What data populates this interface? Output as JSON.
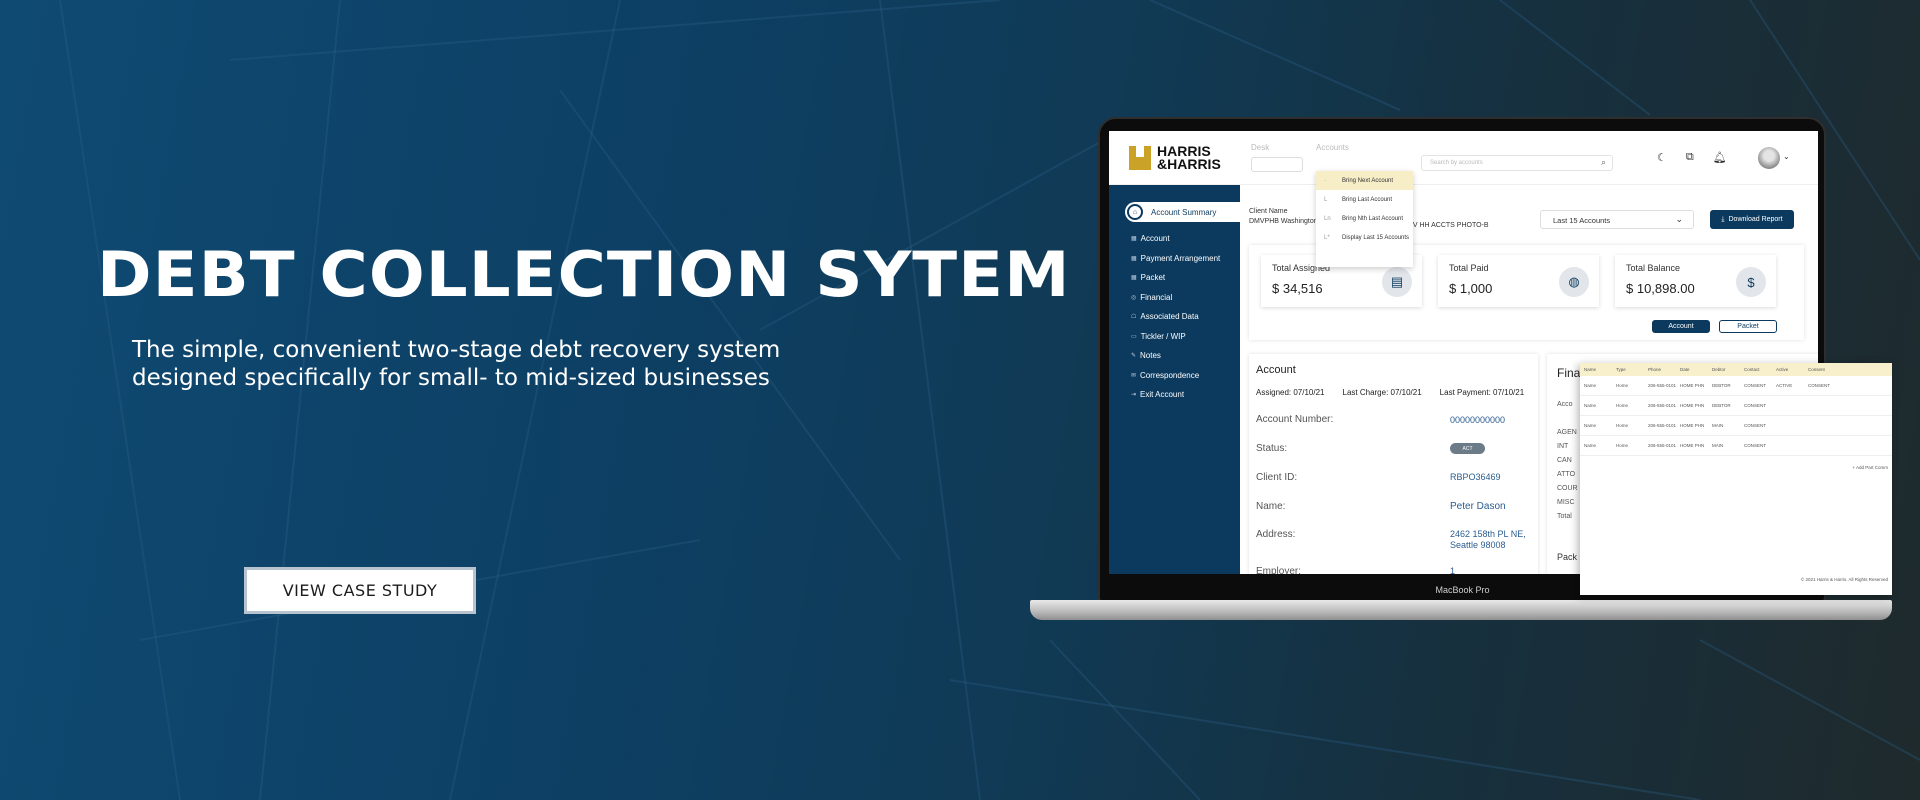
{
  "hero": {
    "title": "DEBT COLLECTION SYTEM",
    "subtitle_line1": "The simple, convenient two-stage debt recovery system",
    "subtitle_line2": "designed specifically for small- to mid-sized businesses",
    "cta_label": "VIEW CASE STUDY"
  },
  "laptop": {
    "label": "MacBook Pro"
  },
  "app": {
    "logo_line1": "HARRIS",
    "logo_line2": "&HARRIS",
    "desk_label": "Desk",
    "accounts_label": "Accounts",
    "accounts_menu": [
      {
        "prefix": "·",
        "label": "Bring Next Account"
      },
      {
        "prefix": "L",
        "label": "Bring Last Account"
      },
      {
        "prefix": "Ln",
        "label": "Bring Nth Last Account"
      },
      {
        "prefix": "L*",
        "label": "Display Last 15 Accounts"
      }
    ],
    "search_placeholder": "Search by accounts",
    "sidebar": {
      "active": "Account Summary",
      "items": [
        "Account",
        "Payment Arrangement",
        "Packet",
        "Financial",
        "Associated Data",
        "Tickler / WIP",
        "Notes",
        "Correspondence",
        "Exit Account"
      ]
    },
    "client_label": "Client Name",
    "client_value": "DMVPHB Washington",
    "client_value2": "MV HH ACCTS PHOTO-B",
    "last_accounts": "Last 15 Accounts",
    "download_report": "Download Report",
    "cards": [
      {
        "title": "Total  Assigned",
        "value": "$ 34,516"
      },
      {
        "title": "Total Paid",
        "value": "$ 1,000"
      },
      {
        "title": "Total Balance",
        "value": "$ 10,898.00"
      }
    ],
    "pill_account": "Account",
    "pill_packet": "Packet",
    "account": {
      "heading": "Account",
      "assigned": "Assigned: 07/10/21",
      "last_charge": "Last Charge: 07/10/21",
      "last_payment": "Last Payment: 07/10/21",
      "rows": [
        {
          "label": "Account Number:",
          "value": "00000000000"
        },
        {
          "label": "Status:",
          "value": "ACT"
        },
        {
          "label": "Client ID:",
          "value": "RBPO36469"
        },
        {
          "label": "Name:",
          "value": "Peter Dason"
        },
        {
          "label": "Address:",
          "value": "2462 158th PL NE,"
        },
        {
          "label": "Employer:",
          "value": "1"
        }
      ],
      "address_line2": "Seattle 98008"
    },
    "financial": {
      "heading": "Fina",
      "sub_labels": [
        "Acco",
        "",
        "AGEN",
        "INT",
        "CAN",
        "ATTO",
        "COUR",
        "MISC",
        "Total"
      ],
      "packet": "Pack"
    },
    "overlay": {
      "headers": [
        "Name",
        "Type",
        "Phone",
        "Date",
        "Debtor",
        "Contact",
        "Active",
        "Consent"
      ],
      "rows": [
        [
          "Name",
          "Home",
          "206-555-0101",
          "HOME PHN",
          "DEBTOR",
          "CONSENT",
          "ACTIVE",
          "CONSENT"
        ],
        [
          "Name",
          "Home",
          "206-555-0101",
          "HOME PHN",
          "DEBTOR",
          "CONSENT",
          "",
          ""
        ],
        [
          "Name",
          "Home",
          "206-555-0101",
          "HOME PHN",
          "MAIN",
          "CONSENT",
          "",
          ""
        ],
        [
          "Name",
          "Home",
          "206-555-0101",
          "HOME PHN",
          "MAIN",
          "CONSENT",
          "",
          ""
        ]
      ],
      "add_label": "+ Add Part Comm",
      "footer": "© 2021 Harris & Harris. All Rights Reserved"
    }
  },
  "colors": {
    "brand_navy": "#0b3a5e",
    "brand_gold": "#c9a227"
  }
}
